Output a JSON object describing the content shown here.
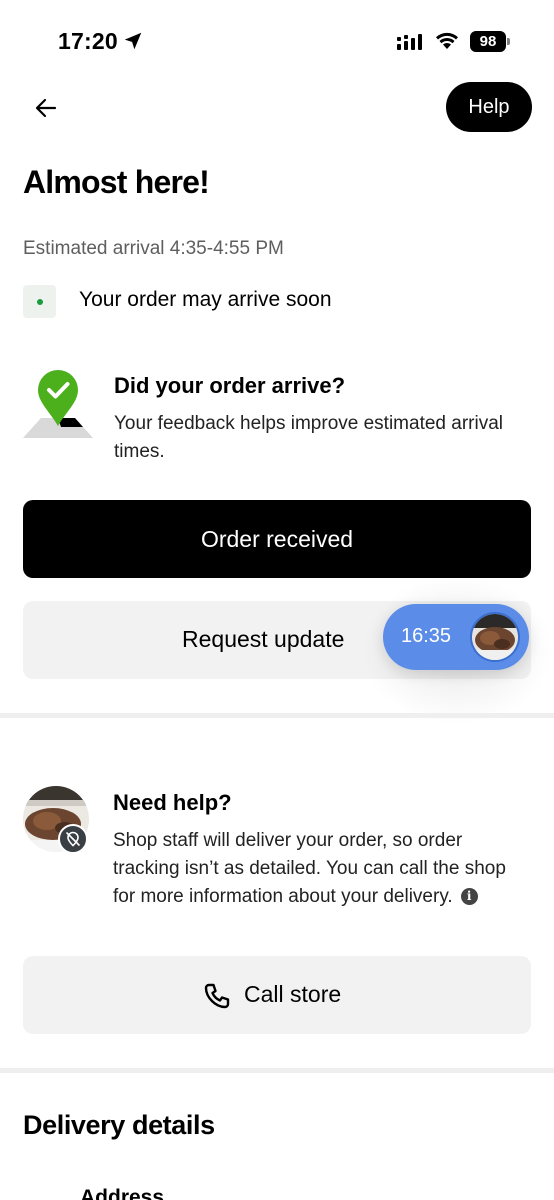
{
  "status_bar": {
    "time": "17:20",
    "battery": "98"
  },
  "header": {
    "help_label": "Help"
  },
  "main": {
    "title": "Almost here!",
    "eta": "Estimated arrival 4:35-4:55 PM",
    "status_text": "Your order may arrive soon",
    "status_color": "#1a9c3c"
  },
  "feedback": {
    "title": "Did your order arrive?",
    "description": "Your feedback helps improve estimated arrival times.",
    "pin_color": "#4caf1c"
  },
  "actions": {
    "order_received_label": "Order received",
    "request_update_label": "Request update",
    "timer": "16:35",
    "timer_color": "#5b8de8"
  },
  "help_section": {
    "title": "Need help?",
    "description": "Shop staff will deliver your order, so order tracking isn’t as detailed. You can call the shop for more information about your delivery.",
    "call_label": "Call store"
  },
  "delivery": {
    "title": "Delivery details",
    "address_label": "Address"
  }
}
